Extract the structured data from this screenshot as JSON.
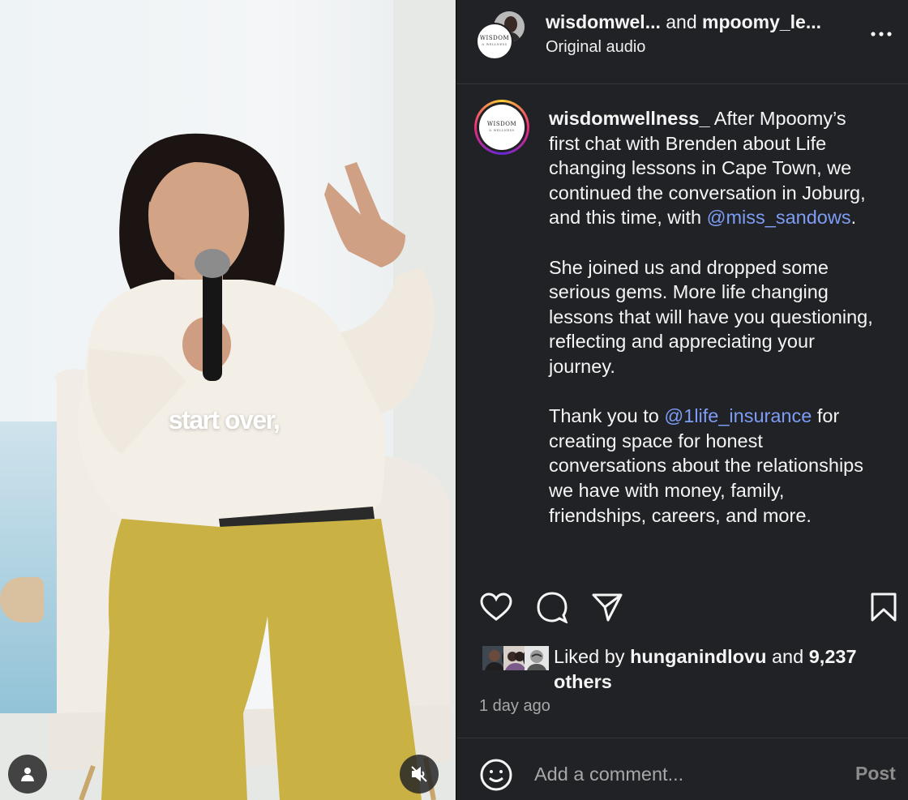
{
  "video": {
    "caption_overlay": "start over,",
    "user_tag_icon": "user-icon",
    "mute_icon": "speaker-muted-icon"
  },
  "header": {
    "author_primary": "wisdomwel...",
    "connector": "and",
    "author_secondary": "mpoomy_le...",
    "audio": "Original audio",
    "more_icon": "more-horizontal-icon"
  },
  "logo": {
    "main": "WISDOM",
    "sub": "& WELLNESS"
  },
  "caption": {
    "username": "wisdomwellness_",
    "p1_text": "After Mpoomy’s first chat with Brenden about Life changing lessons in Cape Town, we continued the conversation in Joburg, and this time, with",
    "p1_mention": "@miss_sandows",
    "p1_end": ".",
    "p2_text": "She joined us and dropped some serious gems. More life changing lessons that will have you questioning, reflecting and appreciating your journey.",
    "p3_start": "Thank you to",
    "p3_mention": "@1life_insurance",
    "p3_text": "for creating space for honest conversations about the relationships we have with money, family, friendships, careers, and more."
  },
  "actions": {
    "like_icon": "heart-icon",
    "comment_icon": "comment-icon",
    "share_icon": "paper-plane-icon",
    "save_icon": "bookmark-icon"
  },
  "likes": {
    "prefix": "Liked by",
    "user": "hunganindlovu",
    "connector": "and",
    "count": "9,237",
    "suffix": "others"
  },
  "timestamp": "1 day ago",
  "comment": {
    "placeholder": "Add a comment...",
    "post_label": "Post",
    "emoji_icon": "smiley-icon"
  },
  "colors": {
    "panel_bg": "#212225",
    "mention": "#7d9cf5",
    "muted_text": "#a8a8a8"
  }
}
